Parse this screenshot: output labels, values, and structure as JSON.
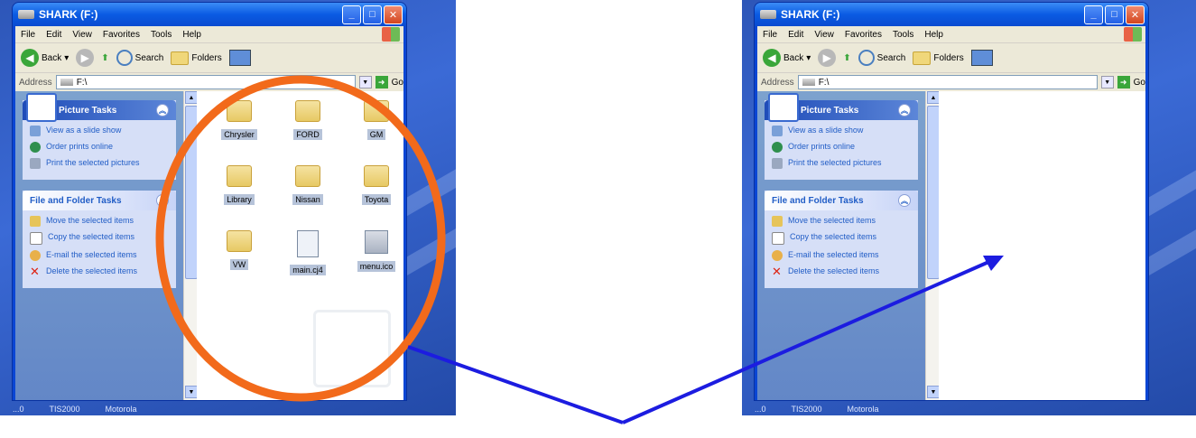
{
  "window": {
    "title": "SHARK (F:)",
    "menu": [
      "File",
      "Edit",
      "View",
      "Favorites",
      "Tools",
      "Help"
    ],
    "toolbar": {
      "back": "Back",
      "search": "Search",
      "folders": "Folders"
    },
    "address": {
      "label": "Address",
      "value": "F:\\",
      "go": "Go"
    }
  },
  "taskpane": {
    "picture_tasks": {
      "title": "Picture Tasks",
      "items": [
        "View as a slide show",
        "Order prints online",
        "Print the selected pictures"
      ]
    },
    "file_tasks": {
      "title": "File and Folder Tasks",
      "items": [
        "Move the selected items",
        "Copy the selected items",
        "E-mail the selected items",
        "Delete the selected items"
      ]
    }
  },
  "files": [
    {
      "name": "Chrysler",
      "type": "folder"
    },
    {
      "name": "FORD",
      "type": "folder"
    },
    {
      "name": "GM",
      "type": "folder"
    },
    {
      "name": "Library",
      "type": "folder"
    },
    {
      "name": "Nissan",
      "type": "folder"
    },
    {
      "name": "Toyota",
      "type": "folder"
    },
    {
      "name": "VW",
      "type": "folder"
    },
    {
      "name": "main.cj4",
      "type": "doc"
    },
    {
      "name": "menu.ico",
      "type": "icon"
    }
  ],
  "taskbar": [
    "...0",
    "TIS2000",
    "Motorola"
  ],
  "annotation": {
    "circle_color": "#f26a1b",
    "arrow_color": "#1c1ce0"
  }
}
